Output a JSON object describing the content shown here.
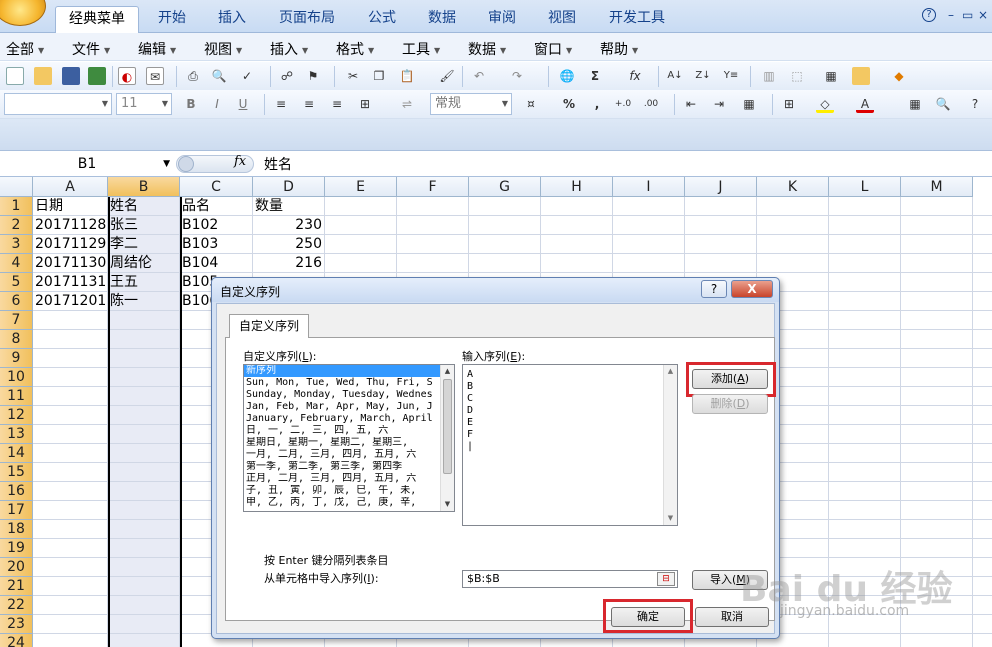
{
  "ribbon": {
    "tabs": [
      "经典菜单",
      "开始",
      "插入",
      "页面布局",
      "公式",
      "数据",
      "审阅",
      "视图",
      "开发工具"
    ],
    "help_icon": "?",
    "minimize_icon": "–",
    "restore_icon": "▭",
    "close_icon": "×"
  },
  "menubar": {
    "items": [
      "全部",
      "文件",
      "编辑",
      "视图",
      "插入",
      "格式",
      "工具",
      "数据",
      "窗口",
      "帮助"
    ]
  },
  "format_toolbar": {
    "font_size": "11",
    "number_format": "常规"
  },
  "formula_bar": {
    "name_box": "B1",
    "fx_label": "fx",
    "content": "姓名"
  },
  "sheet": {
    "columns": [
      "A",
      "B",
      "C",
      "D",
      "E",
      "F",
      "G",
      "H",
      "I",
      "J",
      "K",
      "L",
      "M"
    ],
    "selected_column": "B",
    "rows": [
      "1",
      "2",
      "3",
      "4",
      "5",
      "6",
      "7",
      "8",
      "9",
      "10",
      "11",
      "12",
      "13",
      "14",
      "15",
      "16",
      "17",
      "18",
      "19",
      "20",
      "21",
      "22",
      "23",
      "24"
    ],
    "data": [
      [
        "日期",
        "姓名",
        "品名",
        "数量"
      ],
      [
        "20171128",
        "张三",
        "B102",
        "230"
      ],
      [
        "20171129",
        "李二",
        "B103",
        "250"
      ],
      [
        "20171130",
        "周结伦",
        "B104",
        "216"
      ],
      [
        "20171131",
        "王五",
        "B105",
        ""
      ],
      [
        "20171201",
        "陈一",
        "B106",
        ""
      ]
    ]
  },
  "dialog": {
    "title": "自定义序列",
    "help_button": "?",
    "close_button": "X",
    "tab_label": "自定义序列",
    "custom_lists_label": "自定义序列(L):",
    "custom_lists_label_prefix": "自定义序列(",
    "custom_lists_label_key": "L",
    "custom_lists_label_suffix": "):",
    "custom_lists": [
      "新序列",
      "Sun, Mon, Tue, Wed, Thu, Fri, S",
      "Sunday, Monday, Tuesday, Wednes",
      "Jan, Feb, Mar, Apr, May, Jun, J",
      "January, February, March, April",
      "日, 一, 二, 三, 四, 五, 六",
      "星期日, 星期一, 星期二, 星期三,",
      "一月, 二月, 三月, 四月, 五月, 六",
      "第一季, 第二季, 第三季, 第四季",
      "正月, 二月, 三月, 四月, 五月, 六",
      "子, 丑, 寅, 卯, 辰, 巳, 午, 未,",
      "甲, 乙, 丙, 丁, 戊, 己, 庚, 辛,"
    ],
    "input_label_prefix": "输入序列(",
    "input_label_key": "E",
    "input_label_suffix": "):",
    "input_entries": [
      "A",
      "B",
      "C",
      "D",
      "E",
      "F",
      "|"
    ],
    "add_button_prefix": "添加(",
    "add_button_key": "A",
    "add_button_suffix": ")",
    "delete_button_prefix": "删除(",
    "delete_button_key": "D",
    "delete_button_suffix": ")",
    "hint_text": "按 Enter 键分隔列表条目",
    "import_label_prefix": "从单元格中导入序列(",
    "import_label_key": "I",
    "import_label_suffix": "):",
    "import_range": "$B:$B",
    "import_button_prefix": "导入(",
    "import_button_key": "M",
    "import_button_suffix": ")",
    "ok_button": "确定",
    "cancel_button": "取消"
  },
  "watermark": {
    "text": "Bai du 经验",
    "sub": "jingyan.baidu.com"
  },
  "colors": {
    "highlight": "#d8282e",
    "selected_header": "#f1c05c",
    "list_selection": "#3399ff"
  }
}
